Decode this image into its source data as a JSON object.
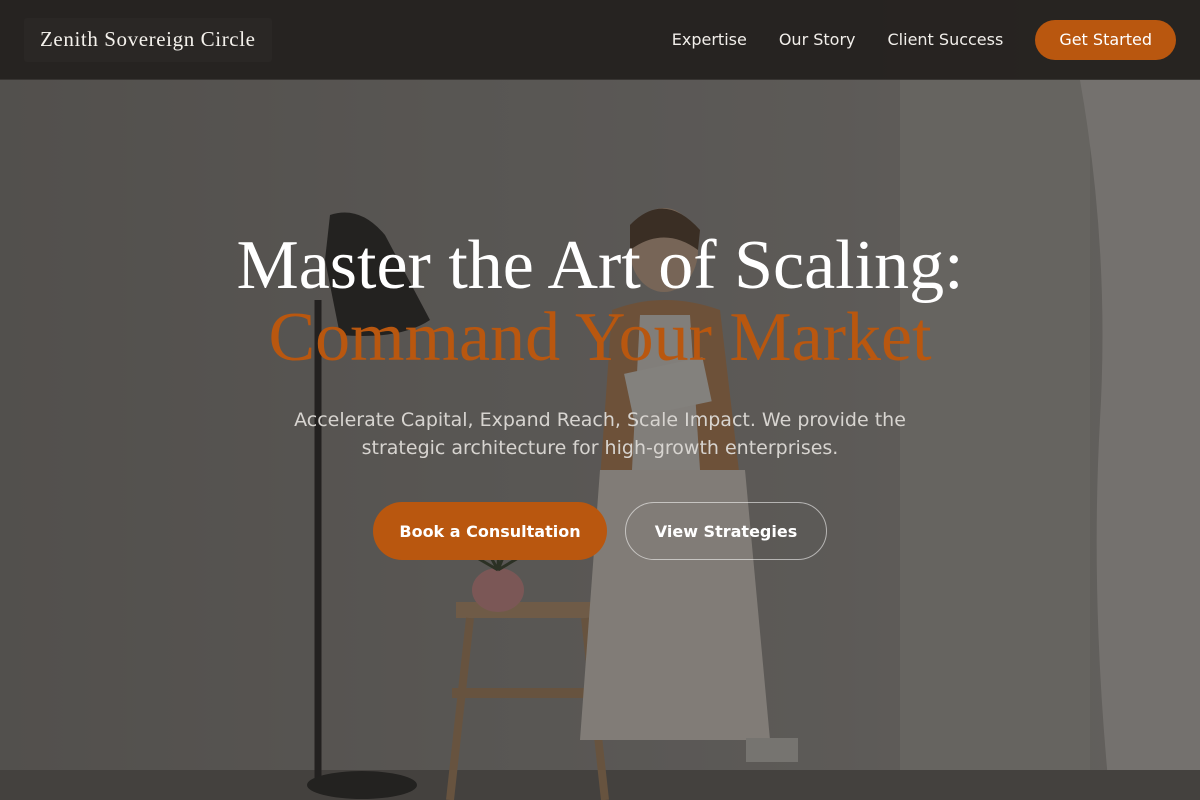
{
  "nav": {
    "brand": "Zenith Sovereign Circle",
    "links": [
      "Expertise",
      "Our Story",
      "Client Success"
    ],
    "cta": "Get Started"
  },
  "hero": {
    "headline_line1": "Master the Art of Scaling:",
    "headline_line2": "Command Your Market",
    "subtitle": "Accelerate Capital, Expand Reach, Scale Impact. We provide the strategic architecture for high-growth enterprises.",
    "primary_button": "Book a Consultation",
    "secondary_button": "View Strategies"
  },
  "colors": {
    "accent": "#b9570f",
    "nav_background": "#24211f",
    "overlay": "#1c1a18"
  }
}
